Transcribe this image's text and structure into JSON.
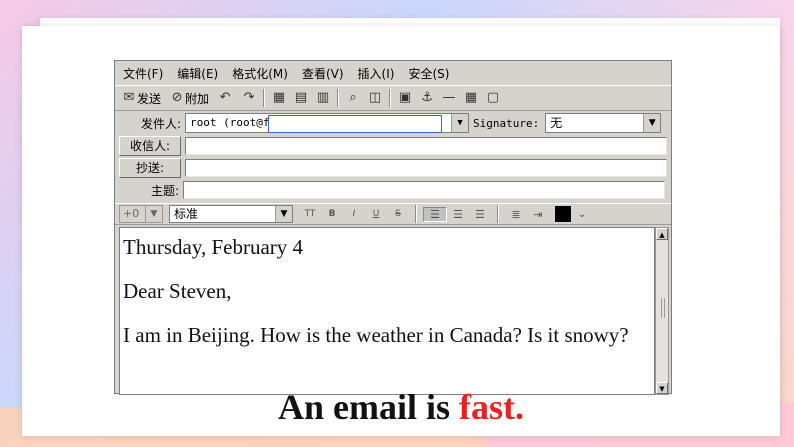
{
  "menu": [
    "文件(F)",
    "编辑(E)",
    "格式化(M)",
    "查看(V)",
    "插入(I)",
    "安全(S)"
  ],
  "toolbar": {
    "send_label": "发送",
    "attach_label": "附加"
  },
  "header_fields": {
    "from_label": "发件人:",
    "from_value": "root (root@f",
    "signature_label": "Signature:",
    "signature_value": "无",
    "to_label": "收信人:",
    "cc_label": "抄送:",
    "subject_label": "主题:"
  },
  "format_bar": {
    "font_size": "+0",
    "paragraph_style": "标准",
    "tt_label": "TT",
    "bold_label": "B",
    "italic_label": "I",
    "underline_label": "U",
    "strike_label": "S"
  },
  "body": {
    "date_line": "Thursday, February 4",
    "greeting": "Dear Steven,",
    "message": "I am in Beijing. How is the weather in Canada? Is it snowy?"
  },
  "caption": {
    "prefix": "An email is ",
    "highlight": "fast."
  },
  "colors": {
    "highlight": "#e8231f",
    "window_bg": "#d6d3ce"
  }
}
